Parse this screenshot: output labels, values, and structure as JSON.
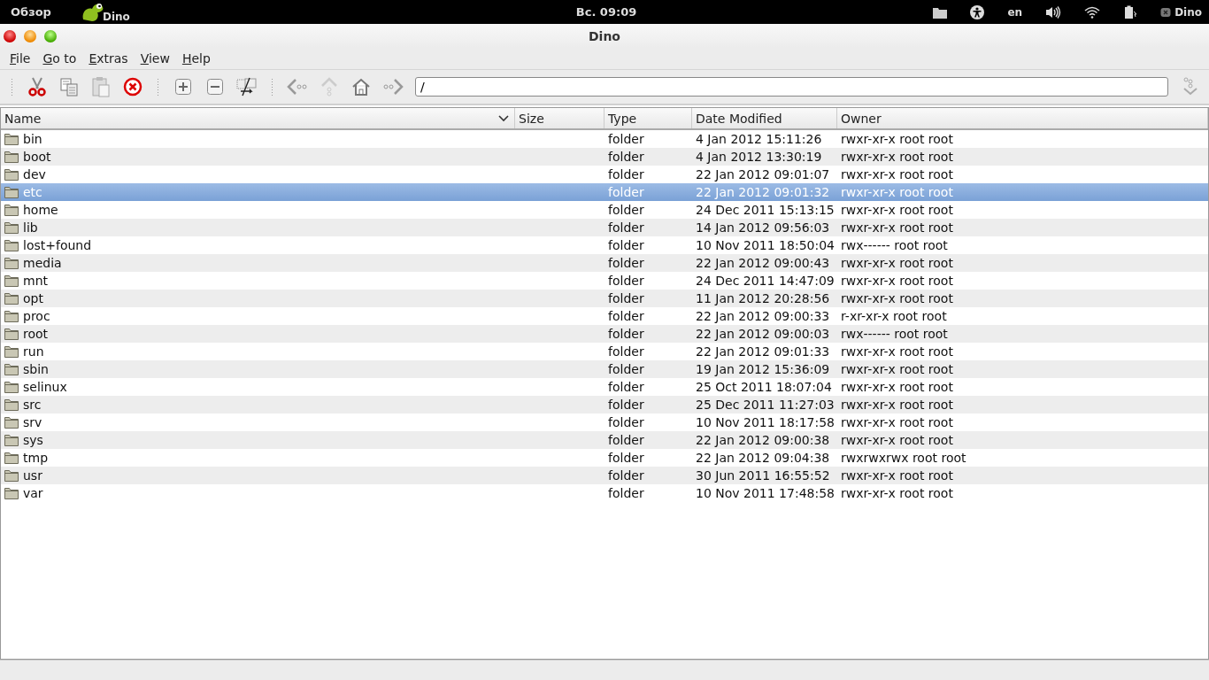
{
  "top_bar": {
    "activities": "Обзор",
    "app": "Dino",
    "clock": "Вс. 09:09",
    "language": "en",
    "user": "Dino"
  },
  "window": {
    "title": "Dino"
  },
  "menu": [
    "File",
    "Go to",
    "Extras",
    "View",
    "Help"
  ],
  "location": {
    "value": "/"
  },
  "table": {
    "columns": [
      {
        "label": "Name",
        "sorted": true
      },
      {
        "label": "Size",
        "sorted": false
      },
      {
        "label": "Type",
        "sorted": false
      },
      {
        "label": "Date Modified",
        "sorted": false
      },
      {
        "label": "Owner",
        "sorted": false
      }
    ],
    "rows": [
      {
        "name": "bin",
        "type": "folder",
        "date": "4 Jan 2012 15:11:26",
        "owner": "rwxr-xr-x root root",
        "selected": false
      },
      {
        "name": "boot",
        "type": "folder",
        "date": "4 Jan 2012 13:30:19",
        "owner": "rwxr-xr-x root root",
        "selected": false
      },
      {
        "name": "dev",
        "type": "folder",
        "date": "22 Jan 2012 09:01:07",
        "owner": "rwxr-xr-x root root",
        "selected": false
      },
      {
        "name": "etc",
        "type": "folder",
        "date": "22 Jan 2012 09:01:32",
        "owner": "rwxr-xr-x root root",
        "selected": true
      },
      {
        "name": "home",
        "type": "folder",
        "date": "24 Dec 2011 15:13:15",
        "owner": "rwxr-xr-x root root",
        "selected": false
      },
      {
        "name": "lib",
        "type": "folder",
        "date": "14 Jan 2012 09:56:03",
        "owner": "rwxr-xr-x root root",
        "selected": false
      },
      {
        "name": "lost+found",
        "type": "folder",
        "date": "10 Nov 2011 18:50:04",
        "owner": "rwx------ root root",
        "selected": false
      },
      {
        "name": "media",
        "type": "folder",
        "date": "22 Jan 2012 09:00:43",
        "owner": "rwxr-xr-x root root",
        "selected": false
      },
      {
        "name": "mnt",
        "type": "folder",
        "date": "24 Dec 2011 14:47:09",
        "owner": "rwxr-xr-x root root",
        "selected": false
      },
      {
        "name": "opt",
        "type": "folder",
        "date": "11 Jan 2012 20:28:56",
        "owner": "rwxr-xr-x root root",
        "selected": false
      },
      {
        "name": "proc",
        "type": "folder",
        "date": "22 Jan 2012 09:00:33",
        "owner": "r-xr-xr-x root root",
        "selected": false
      },
      {
        "name": "root",
        "type": "folder",
        "date": "22 Jan 2012 09:00:03",
        "owner": "rwx------ root root",
        "selected": false
      },
      {
        "name": "run",
        "type": "folder",
        "date": "22 Jan 2012 09:01:33",
        "owner": "rwxr-xr-x root root",
        "selected": false
      },
      {
        "name": "sbin",
        "type": "folder",
        "date": "19 Jan 2012 15:36:09",
        "owner": "rwxr-xr-x root root",
        "selected": false
      },
      {
        "name": "selinux",
        "type": "folder",
        "date": "25 Oct 2011 18:07:04",
        "owner": "rwxr-xr-x root root",
        "selected": false
      },
      {
        "name": "src",
        "type": "folder",
        "date": "25 Dec 2011 11:27:03",
        "owner": "rwxr-xr-x root root",
        "selected": false
      },
      {
        "name": "srv",
        "type": "folder",
        "date": "10 Nov 2011 18:17:58",
        "owner": "rwxr-xr-x root root",
        "selected": false
      },
      {
        "name": "sys",
        "type": "folder",
        "date": "22 Jan 2012 09:00:38",
        "owner": "rwxr-xr-x root root",
        "selected": false
      },
      {
        "name": "tmp",
        "type": "folder",
        "date": "22 Jan 2012 09:04:38",
        "owner": "rwxrwxrwx root root",
        "selected": false
      },
      {
        "name": "usr",
        "type": "folder",
        "date": "30 Jun 2011 16:55:52",
        "owner": "rwxr-xr-x root root",
        "selected": false
      },
      {
        "name": "var",
        "type": "folder",
        "date": "10 Nov 2011 17:48:58",
        "owner": "rwxr-xr-x root root",
        "selected": false
      }
    ]
  }
}
